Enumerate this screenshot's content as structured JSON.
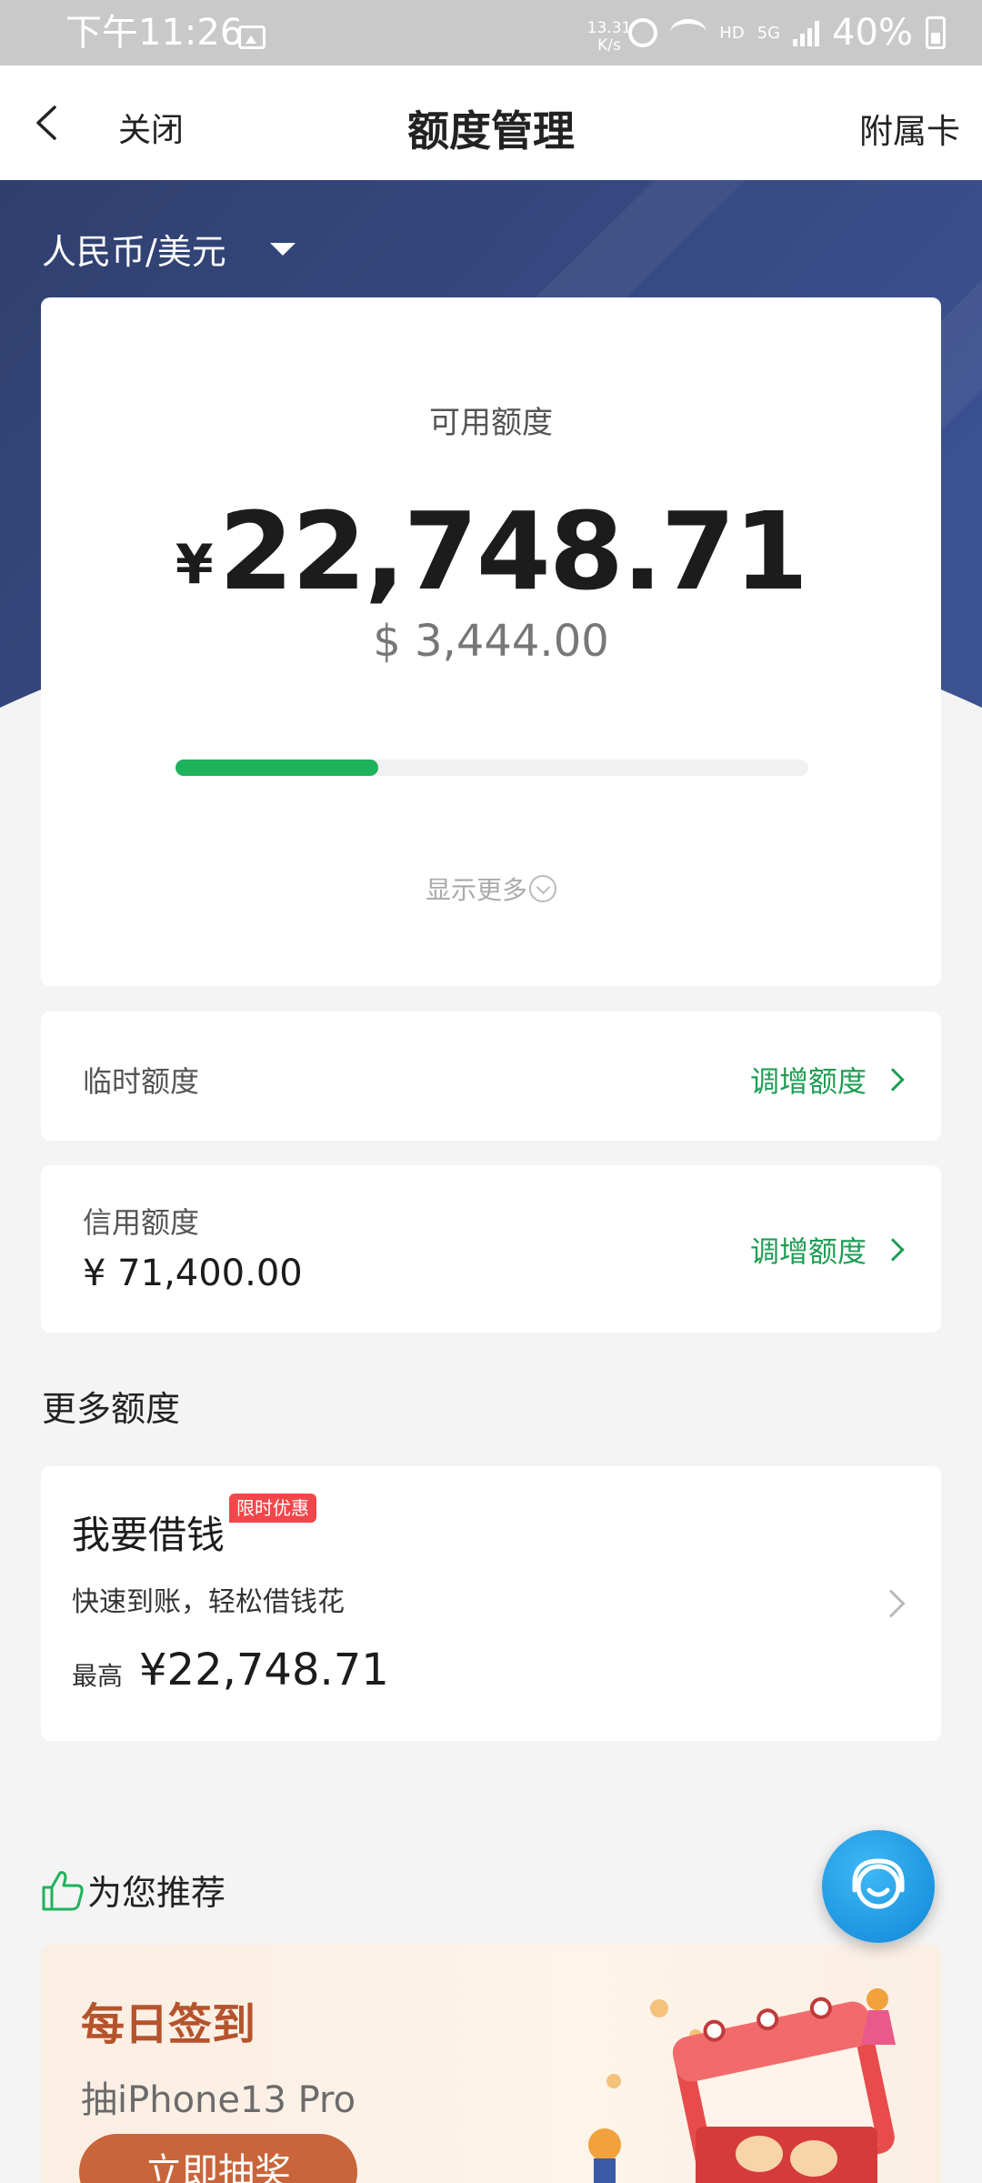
{
  "status_bar": {
    "time": "下午11:26",
    "net_speed_value": "13.31",
    "net_speed_unit": "K/s",
    "hd": "HD",
    "network": "5G",
    "battery": "40%"
  },
  "nav": {
    "close": "关闭",
    "title": "额度管理",
    "right": "附属卡"
  },
  "currency_switch": "人民币/美元",
  "available": {
    "label": "可用额度",
    "symbol": "¥",
    "value": "22,748.71",
    "usd": "$ 3,444.00",
    "usage_fraction": 0.32,
    "show_more": "显示更多"
  },
  "temp_limit": {
    "label": "临时额度",
    "action": "调增额度"
  },
  "credit_limit": {
    "label": "信用额度",
    "value": "¥ 71,400.00",
    "action": "调增额度"
  },
  "more_section": {
    "title": "更多额度"
  },
  "loan": {
    "title": "我要借钱",
    "badge": "限时优惠",
    "subtitle": "快速到账，轻松借钱花",
    "max_label": "最高",
    "max_value": "¥22,748.71"
  },
  "recommend": {
    "title": "为您推荐"
  },
  "promo": {
    "title": "每日签到",
    "subtitle": "抽iPhone13 Pro",
    "button": "立即抽奖"
  },
  "colors": {
    "banner_blue": "#33477c",
    "accent_green": "#1fb25c",
    "badge_red": "#f2474a",
    "fab_blue": "#1a96e3"
  }
}
